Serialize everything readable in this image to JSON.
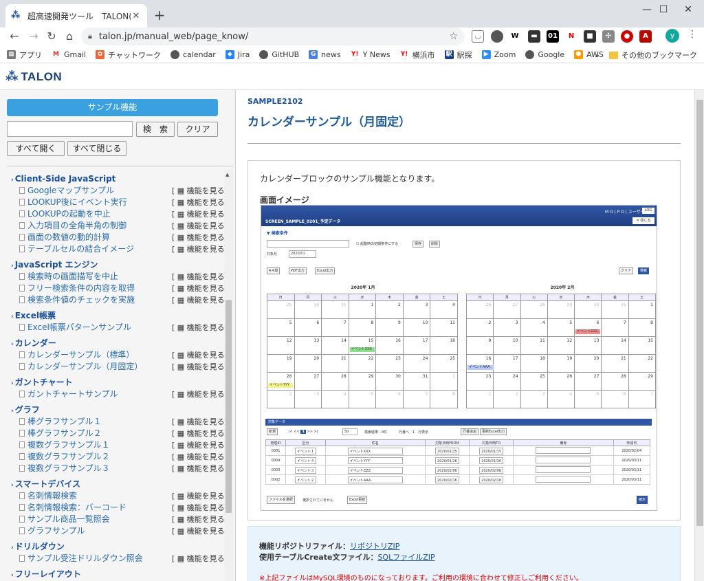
{
  "browser": {
    "tab_title": "超高速開発ツール　TALON(タロン)",
    "url": "talon.jp/manual_web/page_know/",
    "avatar_letter": "y",
    "bookmarks": [
      "アプリ",
      "Gmail",
      "チャットワーク",
      "calendar",
      "Jira",
      "GitHUB",
      "news",
      "Y News",
      "横浜市",
      "駅探",
      "Zoom",
      "Google",
      "AWS"
    ],
    "other_bookmarks": "その他のブックマーク",
    "more_bookmarks": "»"
  },
  "app": {
    "logo": "TALON"
  },
  "sidebar": {
    "title": "サンプル機能",
    "search_placeholder": "",
    "search_btn": "検　索",
    "clear_btn": "クリア",
    "expand_all": "すべて開く",
    "collapse_all": "すべて閉じる",
    "func_label": "[ ▦ 機能を見る ]",
    "categories": [
      {
        "name": "Client-Side JavaScript",
        "items": [
          "Googleマップサンプル",
          "LOOKUP後にイベント実行",
          "LOOKUPの起動を中止",
          "入力項目の全角半角の制御",
          "画面の数値の動的計算",
          "テーブルセルの結合イメージ"
        ]
      },
      {
        "name": "JavaScript エンジン",
        "items": [
          "検索時の画面描写を中止",
          "フリー検索条件の内容を取得",
          "検索条件値のチェックを実施"
        ]
      },
      {
        "name": "Excel帳票",
        "items": [
          "Excel帳票パターンサンプル"
        ]
      },
      {
        "name": "カレンダー",
        "items": [
          "カレンダーサンプル（標準）",
          "カレンダーサンプル（月固定）"
        ]
      },
      {
        "name": "ガントチャート",
        "items": [
          "ガントチャートサンプル"
        ]
      },
      {
        "name": "グラフ",
        "items": [
          "棒グラフサンプル１",
          "棒グラフサンプル２",
          "複数グラフサンプル１",
          "複数グラフサンプル２",
          "複数グラフサンプル３"
        ]
      },
      {
        "name": "スマートデバイス",
        "items": [
          "名刺情報検索",
          "名刺情報検索：バーコード",
          "サンプル商品一覧照会",
          "グラフサンプル"
        ]
      },
      {
        "name": "ドリルダウン",
        "items": [
          "サンプル受注ドリルダウン照会"
        ]
      },
      {
        "name": "フリーレイアウト",
        "items": []
      }
    ]
  },
  "main": {
    "code": "SAMPLE2102",
    "title": "カレンダーサンプル（月固定）",
    "description": "カレンダーブロックのサンプル機能となります。",
    "image_label": "画面イメージ",
    "preview": {
      "screen_name": "SCREEN_SAMPLE_0201_予定データ",
      "user": "M O | P O | ユーザー",
      "log_btn": "LOG",
      "close_btn": "✕ 閉じる",
      "cond_label": "▼ 検索条件",
      "checkbox_label": "起動時の初期条件にする",
      "save_btn": "保存",
      "delete_btn": "削除",
      "month_label": "対象月",
      "month_value": "2020/01",
      "a4_btn": "A４縦",
      "pdf_btn": "PDF出力",
      "excel_btn": "Excel出力",
      "clear_btn": "クリア",
      "search_btn": "検索",
      "weekdays": [
        "日",
        "月",
        "火",
        "水",
        "木",
        "金",
        "土"
      ],
      "cal1_title": "2020年 1月",
      "cal1_days": [
        "29",
        "30",
        "31",
        "1",
        "2",
        "3",
        "4",
        "5",
        "6",
        "7",
        "8",
        "9",
        "10",
        "11",
        "12",
        "13",
        "14",
        "15",
        "16",
        "17",
        "18",
        "19",
        "20",
        "21",
        "22",
        "23",
        "24",
        "25",
        "26",
        "27",
        "28",
        "29",
        "30",
        "31",
        "1",
        "2",
        "3",
        "4",
        "5",
        "6",
        "7",
        "8"
      ],
      "cal2_title": "2020年 2月",
      "cal2_days": [
        "26",
        "27",
        "28",
        "29",
        "30",
        "31",
        "1",
        "2",
        "3",
        "4",
        "5",
        "6",
        "7",
        "8",
        "9",
        "10",
        "11",
        "12",
        "13",
        "14",
        "15",
        "16",
        "17",
        "18",
        "19",
        "20",
        "21",
        "22",
        "23",
        "24",
        "25",
        "26",
        "27",
        "28",
        "29",
        "1",
        "2",
        "3",
        "4",
        "5",
        "6",
        "7"
      ],
      "events": {
        "xxx": "イベントXXX",
        "yyy": "イベントYYY",
        "zzz": "イベントZZZ",
        "aaa": "イベントAAA"
      },
      "table_title": "対象データ",
      "new_btn": "新規",
      "page_size": "50",
      "result_text": "検索結果：4件",
      "goto_text": "行番へ　1　行表示",
      "pager_btn": "行番追加",
      "excel_update": "更新Excel出力",
      "columns": [
        "管理ID",
        "区分",
        "件名",
        "対象日時FROM",
        "対象日時TO",
        "備考",
        "作成日"
      ],
      "rows": [
        [
          "0001",
          "イベント１",
          "イベントXXX",
          "2020/01/15",
          "2020/01/15",
          "",
          "2020/02/04"
        ],
        [
          "0004",
          "イベント４",
          "イベントYYY",
          "2020/01/26",
          "2020/01/26",
          "",
          "2020/03/11"
        ],
        [
          "0003",
          "イベント３",
          "イベントZZZ",
          "2020/02/06",
          "2020/02/06",
          "",
          "2020/03/11"
        ],
        [
          "0002",
          "イベント２",
          "イベントAAA",
          "2020/02/16",
          "2020/02/18",
          "",
          "2020/03/11"
        ]
      ],
      "file_btn": "ファイルを選択",
      "file_none": "選択されていません",
      "excel_reflect": "Excel更新",
      "confirm_btn": "確定"
    },
    "footer": {
      "repo_label": "機能リポジトリファイル：",
      "repo_link": "リポジトリZIP",
      "sql_label": "使用テーブルCreate文ファイル：",
      "sql_link": "SQLファイルZIP",
      "note": "※上記ファイルはMySQL環境のものになっております。ご利用の環境に合わせて修正しご利用ください。"
    }
  }
}
